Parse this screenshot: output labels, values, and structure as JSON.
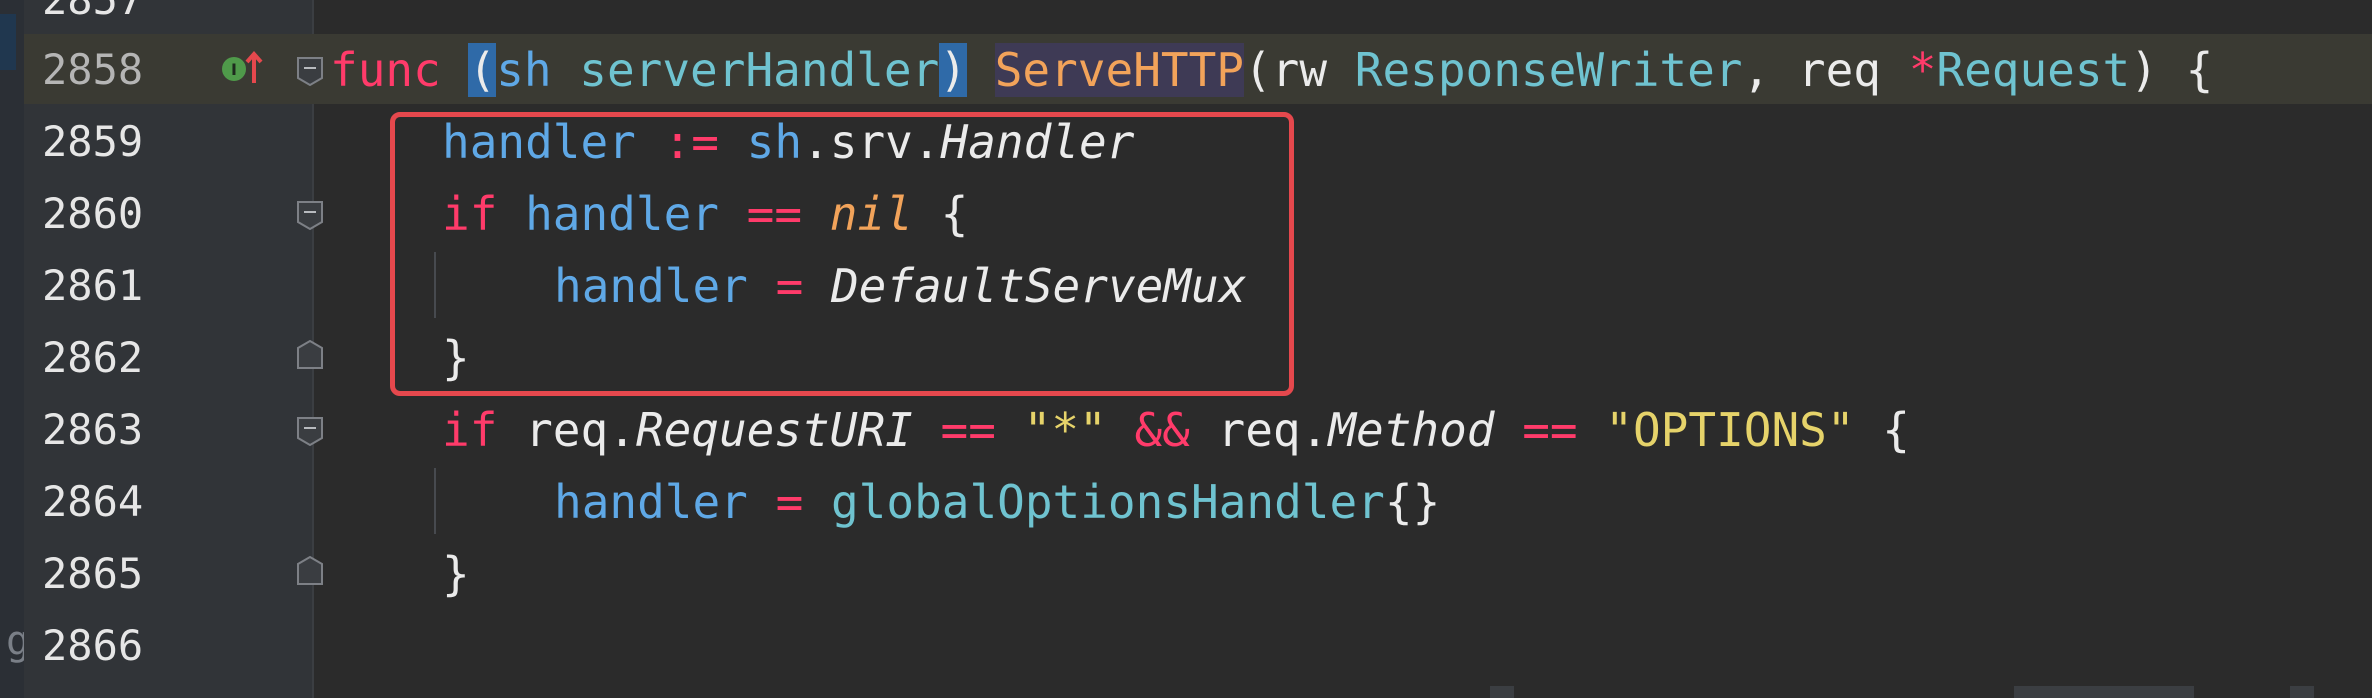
{
  "editor": {
    "language": "go",
    "highlight_box_color": "#e5484d",
    "left_strip_glyph": "g",
    "lines": [
      {
        "number": "2857",
        "current": false,
        "fold": "none"
      },
      {
        "number": "2858",
        "current": true,
        "fold": "open",
        "has_impl_icon": true
      },
      {
        "number": "2859",
        "current": false,
        "fold": "none"
      },
      {
        "number": "2860",
        "current": false,
        "fold": "open"
      },
      {
        "number": "2861",
        "current": false,
        "fold": "none"
      },
      {
        "number": "2862",
        "current": false,
        "fold": "close"
      },
      {
        "number": "2863",
        "current": false,
        "fold": "open"
      },
      {
        "number": "2864",
        "current": false,
        "fold": "none"
      },
      {
        "number": "2865",
        "current": false,
        "fold": "close"
      },
      {
        "number": "2866",
        "current": false,
        "fold": "none"
      }
    ],
    "code": {
      "l2858": {
        "func": "func",
        "paren_open": "(",
        "receiver": "sh",
        "receiver_type": "serverHandler",
        "paren_close": ")",
        "method": "ServeHTTP",
        "args_open": "(",
        "arg1": "rw",
        "arg1_type": "ResponseWriter",
        "comma": ", ",
        "arg2": "req",
        "star": "*",
        "arg2_type": "Request",
        "args_close": ")",
        "brace": " {"
      },
      "l2859": {
        "var": "handler",
        "assign": ":=",
        "obj": "sh",
        "dot1": ".srv.",
        "field": "Handler"
      },
      "l2860": {
        "if": "if",
        "var": "handler",
        "eq": "==",
        "nil": "nil",
        "brace": "{"
      },
      "l2861": {
        "var": "handler",
        "eq": "=",
        "value": "DefaultServeMux"
      },
      "l2862": {
        "brace": "}"
      },
      "l2863": {
        "if": "if",
        "obj": "req",
        "dot": ".",
        "field1": "RequestURI",
        "eq1": "==",
        "str1": "\"*\"",
        "and": "&&",
        "obj2": "req",
        "dot2": ".",
        "field2": "Method",
        "eq2": "==",
        "str2": "\"OPTIONS\"",
        "brace": "{"
      },
      "l2864": {
        "var": "handler",
        "eq": "=",
        "value": "globalOptionsHandler",
        "braces": "{}"
      },
      "l2865": {
        "brace": "}"
      }
    }
  }
}
